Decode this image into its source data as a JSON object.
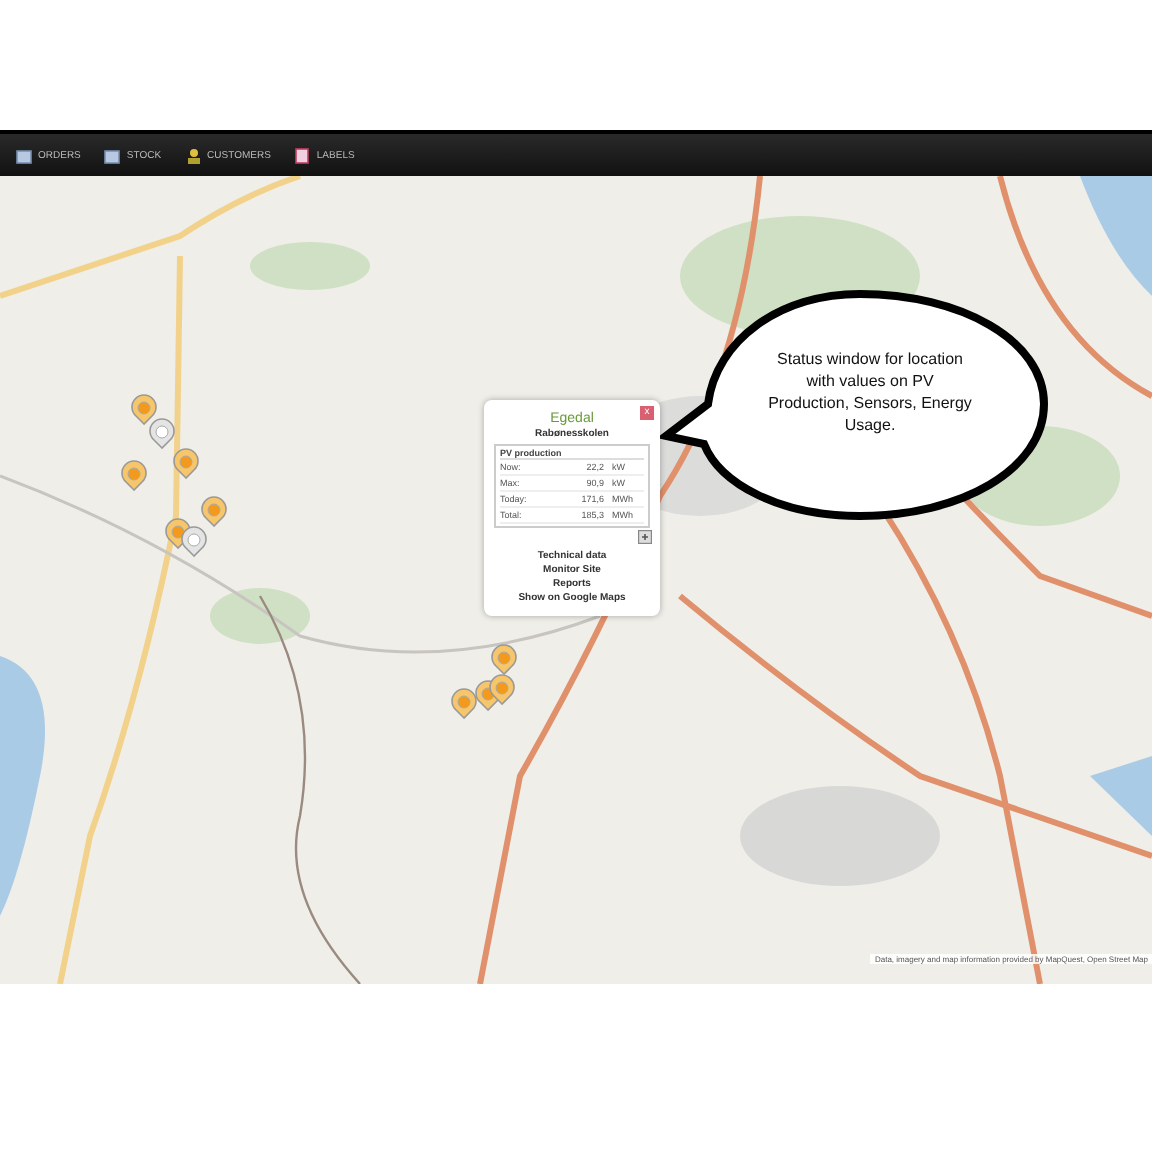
{
  "nav": {
    "items": [
      {
        "label": "ORDERS"
      },
      {
        "label": "STOCK"
      },
      {
        "label": "CUSTOMERS"
      },
      {
        "label": "LABELS"
      }
    ]
  },
  "map": {
    "markers": [
      {
        "kind": "sun"
      },
      {
        "kind": "cloud"
      },
      {
        "kind": "sun"
      },
      {
        "kind": "sun"
      },
      {
        "kind": "sun"
      },
      {
        "kind": "sun"
      },
      {
        "kind": "cloud"
      },
      {
        "kind": "sun"
      },
      {
        "kind": "sun"
      },
      {
        "kind": "sun"
      },
      {
        "kind": "sun"
      }
    ],
    "attribution": "Data, imagery and map information provided by MapQuest, Open Street Map"
  },
  "popup": {
    "title": "Egedal",
    "subtitle": "Rabønesskolen",
    "close": "x",
    "section": "PV production",
    "rows": [
      {
        "label": "Now:",
        "value": "22,2",
        "unit": "kW"
      },
      {
        "label": "Max:",
        "value": "90,9",
        "unit": "kW"
      },
      {
        "label": "Today:",
        "value": "171,6",
        "unit": "MWh"
      },
      {
        "label": "Total:",
        "value": "185,3",
        "unit": "MWh"
      }
    ],
    "links": [
      "Technical data",
      "Monitor Site",
      "Reports",
      "Show on Google Maps"
    ]
  },
  "callout": {
    "text": "Status window for location with values on PV Production, Sensors, Energy Usage."
  }
}
